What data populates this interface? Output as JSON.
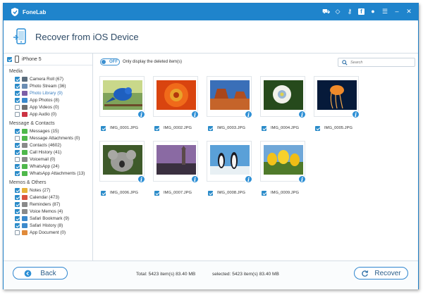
{
  "app": {
    "name": "FoneLab"
  },
  "titlebar": {
    "icons": [
      "cart-icon",
      "diamond-icon",
      "key-icon",
      "facebook-icon",
      "chat-icon",
      "menu-icon",
      "minimize-icon",
      "close-icon"
    ]
  },
  "header": {
    "title": "Recover from iOS Device"
  },
  "sidebar": {
    "device": "iPhone 5",
    "groups": [
      {
        "title": "Media",
        "items": [
          {
            "label": "Camera Roll (67)",
            "checked": true
          },
          {
            "label": "Photo Stream (36)",
            "checked": true
          },
          {
            "label": "Photo Library (9)",
            "checked": true,
            "selected": true
          },
          {
            "label": "App Photos (8)",
            "checked": true
          },
          {
            "label": "App Videos (0)",
            "checked": false
          },
          {
            "label": "App Audio (0)",
            "checked": false
          }
        ]
      },
      {
        "title": "Message & Contacts",
        "items": [
          {
            "label": "Messages (15)",
            "checked": true
          },
          {
            "label": "Message Attachments (0)",
            "checked": false
          },
          {
            "label": "Contacts (4602)",
            "checked": true
          },
          {
            "label": "Call History (41)",
            "checked": true
          },
          {
            "label": "Voicemail (0)",
            "checked": false
          },
          {
            "label": "WhatsApp (24)",
            "checked": true
          },
          {
            "label": "WhatsApp Attachments (13)",
            "checked": true
          }
        ]
      },
      {
        "title": "Memos & Others",
        "items": [
          {
            "label": "Notes (27)",
            "checked": true
          },
          {
            "label": "Calendar (473)",
            "checked": true
          },
          {
            "label": "Reminders (87)",
            "checked": true
          },
          {
            "label": "Voice Memos (4)",
            "checked": true
          },
          {
            "label": "Safari Bookmark (9)",
            "checked": true
          },
          {
            "label": "Safari History (8)",
            "checked": true
          },
          {
            "label": "App Document (0)",
            "checked": false
          }
        ]
      }
    ]
  },
  "toolbar": {
    "toggle_state": "OFF",
    "toggle_label": "Only display the deleted item(s)",
    "search_placeholder": "Search"
  },
  "photos": [
    {
      "name": "IMG_0001.JPG",
      "checked": true
    },
    {
      "name": "IMG_0002.JPG",
      "checked": true
    },
    {
      "name": "IMG_0003.JPG",
      "checked": true
    },
    {
      "name": "IMG_0004.JPG",
      "checked": true
    },
    {
      "name": "IMG_0005.JPG",
      "checked": true
    },
    {
      "name": "IMG_0006.JPG",
      "checked": true
    },
    {
      "name": "IMG_0007.JPG",
      "checked": true
    },
    {
      "name": "IMG_0008.JPG",
      "checked": true
    },
    {
      "name": "IMG_0009.JPG",
      "checked": true
    }
  ],
  "footer": {
    "back_label": "Back",
    "recover_label": "Recover",
    "total_text": "Total: 5423 item(s) 83.40 MB",
    "selected_text": "selected: 5423 item(s) 83.40 MB"
  },
  "colors": {
    "accent": "#1f84cc",
    "border": "#d5dde5"
  }
}
